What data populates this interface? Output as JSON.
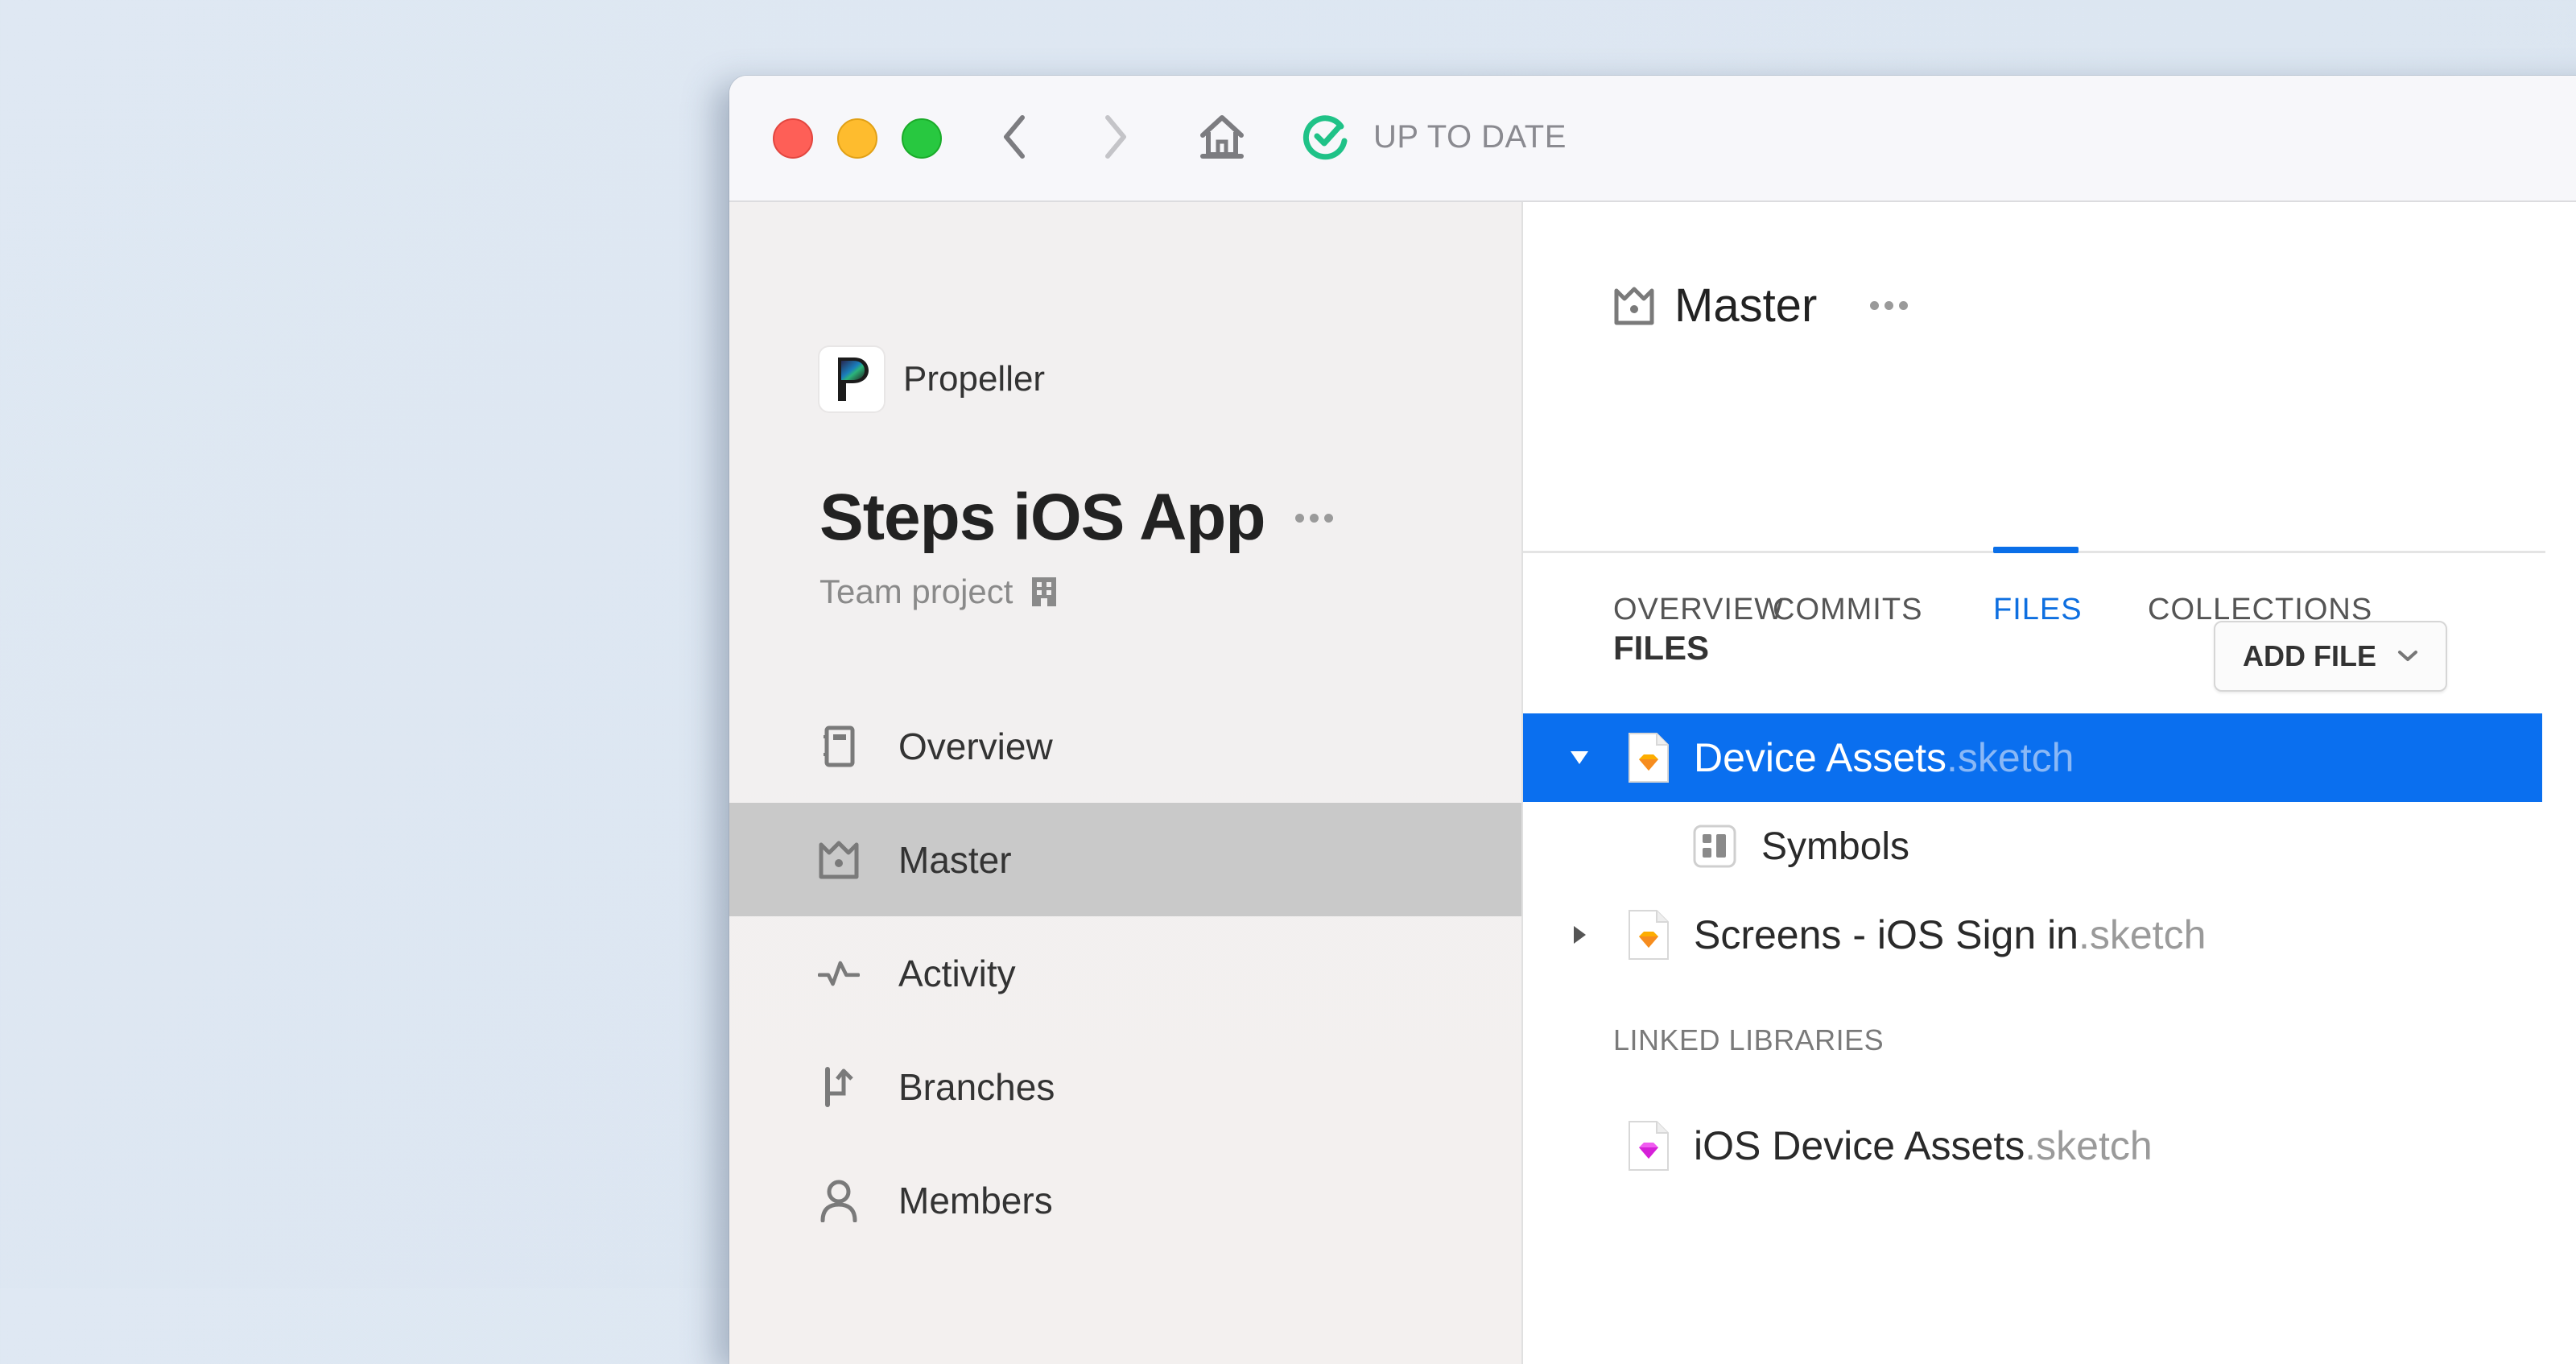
{
  "titlebar": {
    "status_text": "UP TO DATE",
    "status_color": "#1fc287",
    "icons": [
      "close-button",
      "minimize-button",
      "zoom-button",
      "chevron-left-icon",
      "chevron-right-icon",
      "home-icon",
      "check-circle-icon"
    ]
  },
  "sidebar": {
    "org_name": "Propeller",
    "project_title": "Steps iOS App",
    "project_type": "Team project",
    "items": [
      {
        "label": "Overview",
        "icon": "notebook-icon",
        "active": false
      },
      {
        "label": "Master",
        "icon": "crown-icon",
        "active": true
      },
      {
        "label": "Activity",
        "icon": "pulse-icon",
        "active": false
      },
      {
        "label": "Branches",
        "icon": "branch-icon",
        "active": false
      },
      {
        "label": "Members",
        "icon": "person-icon",
        "active": false
      }
    ]
  },
  "main": {
    "branch_title": "Master",
    "tabs": [
      {
        "label": "OVERVIEW",
        "active": false
      },
      {
        "label": "COMMITS",
        "active": false
      },
      {
        "label": "FILES",
        "active": true
      },
      {
        "label": "COLLECTIONS",
        "active": false
      }
    ],
    "accent_color": "#0a6fef",
    "files_header": "FILES",
    "add_file_label": "ADD FILE",
    "files": [
      {
        "name": "Device Assets",
        "ext": ".sketch",
        "expanded": true,
        "selected": true,
        "children": [
          {
            "name": "Symbols"
          }
        ]
      },
      {
        "name": "Screens - iOS Sign in",
        "ext": ".sketch",
        "expanded": false,
        "selected": false
      }
    ],
    "linked_libraries_label": "LINKED LIBRARIES",
    "linked_libraries": [
      {
        "name": "iOS Device Assets",
        "ext": ".sketch"
      }
    ]
  }
}
